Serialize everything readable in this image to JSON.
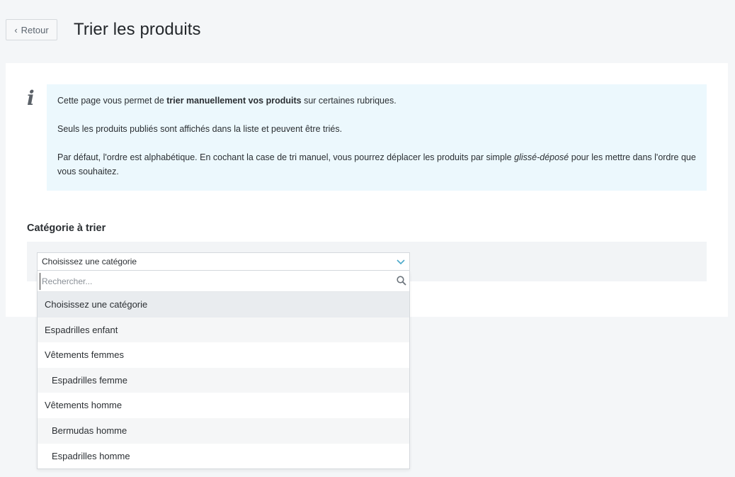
{
  "header": {
    "back_label": "Retour",
    "title": "Trier les produits"
  },
  "info": {
    "p1_pre": "Cette page vous permet de ",
    "p1_bold": "trier manuellement vos produits",
    "p1_post": " sur certaines rubriques.",
    "p2": "Seuls les produits publiés sont affichés dans la liste et peuvent être triés.",
    "p3_pre": "Par défaut, l'ordre est alphabétique. En cochant la case de tri manuel, vous pourrez déplacer les produits par simple ",
    "p3_italic": "glissé-déposé",
    "p3_post": " pour les mettre dans l'ordre que vous souhaitez."
  },
  "category": {
    "section_title": "Catégorie à trier",
    "selected": "Choisissez une catégorie",
    "search_placeholder": "Rechercher...",
    "options": [
      {
        "label": "Choisissez une catégorie",
        "level": 0
      },
      {
        "label": "Espadrilles enfant",
        "level": 0
      },
      {
        "label": "Vêtements femmes",
        "level": 0
      },
      {
        "label": "Espadrilles femme",
        "level": 1
      },
      {
        "label": "Vêtements homme",
        "level": 0
      },
      {
        "label": "Bermudas homme",
        "level": 1
      },
      {
        "label": "Espadrilles homme",
        "level": 1
      }
    ]
  }
}
